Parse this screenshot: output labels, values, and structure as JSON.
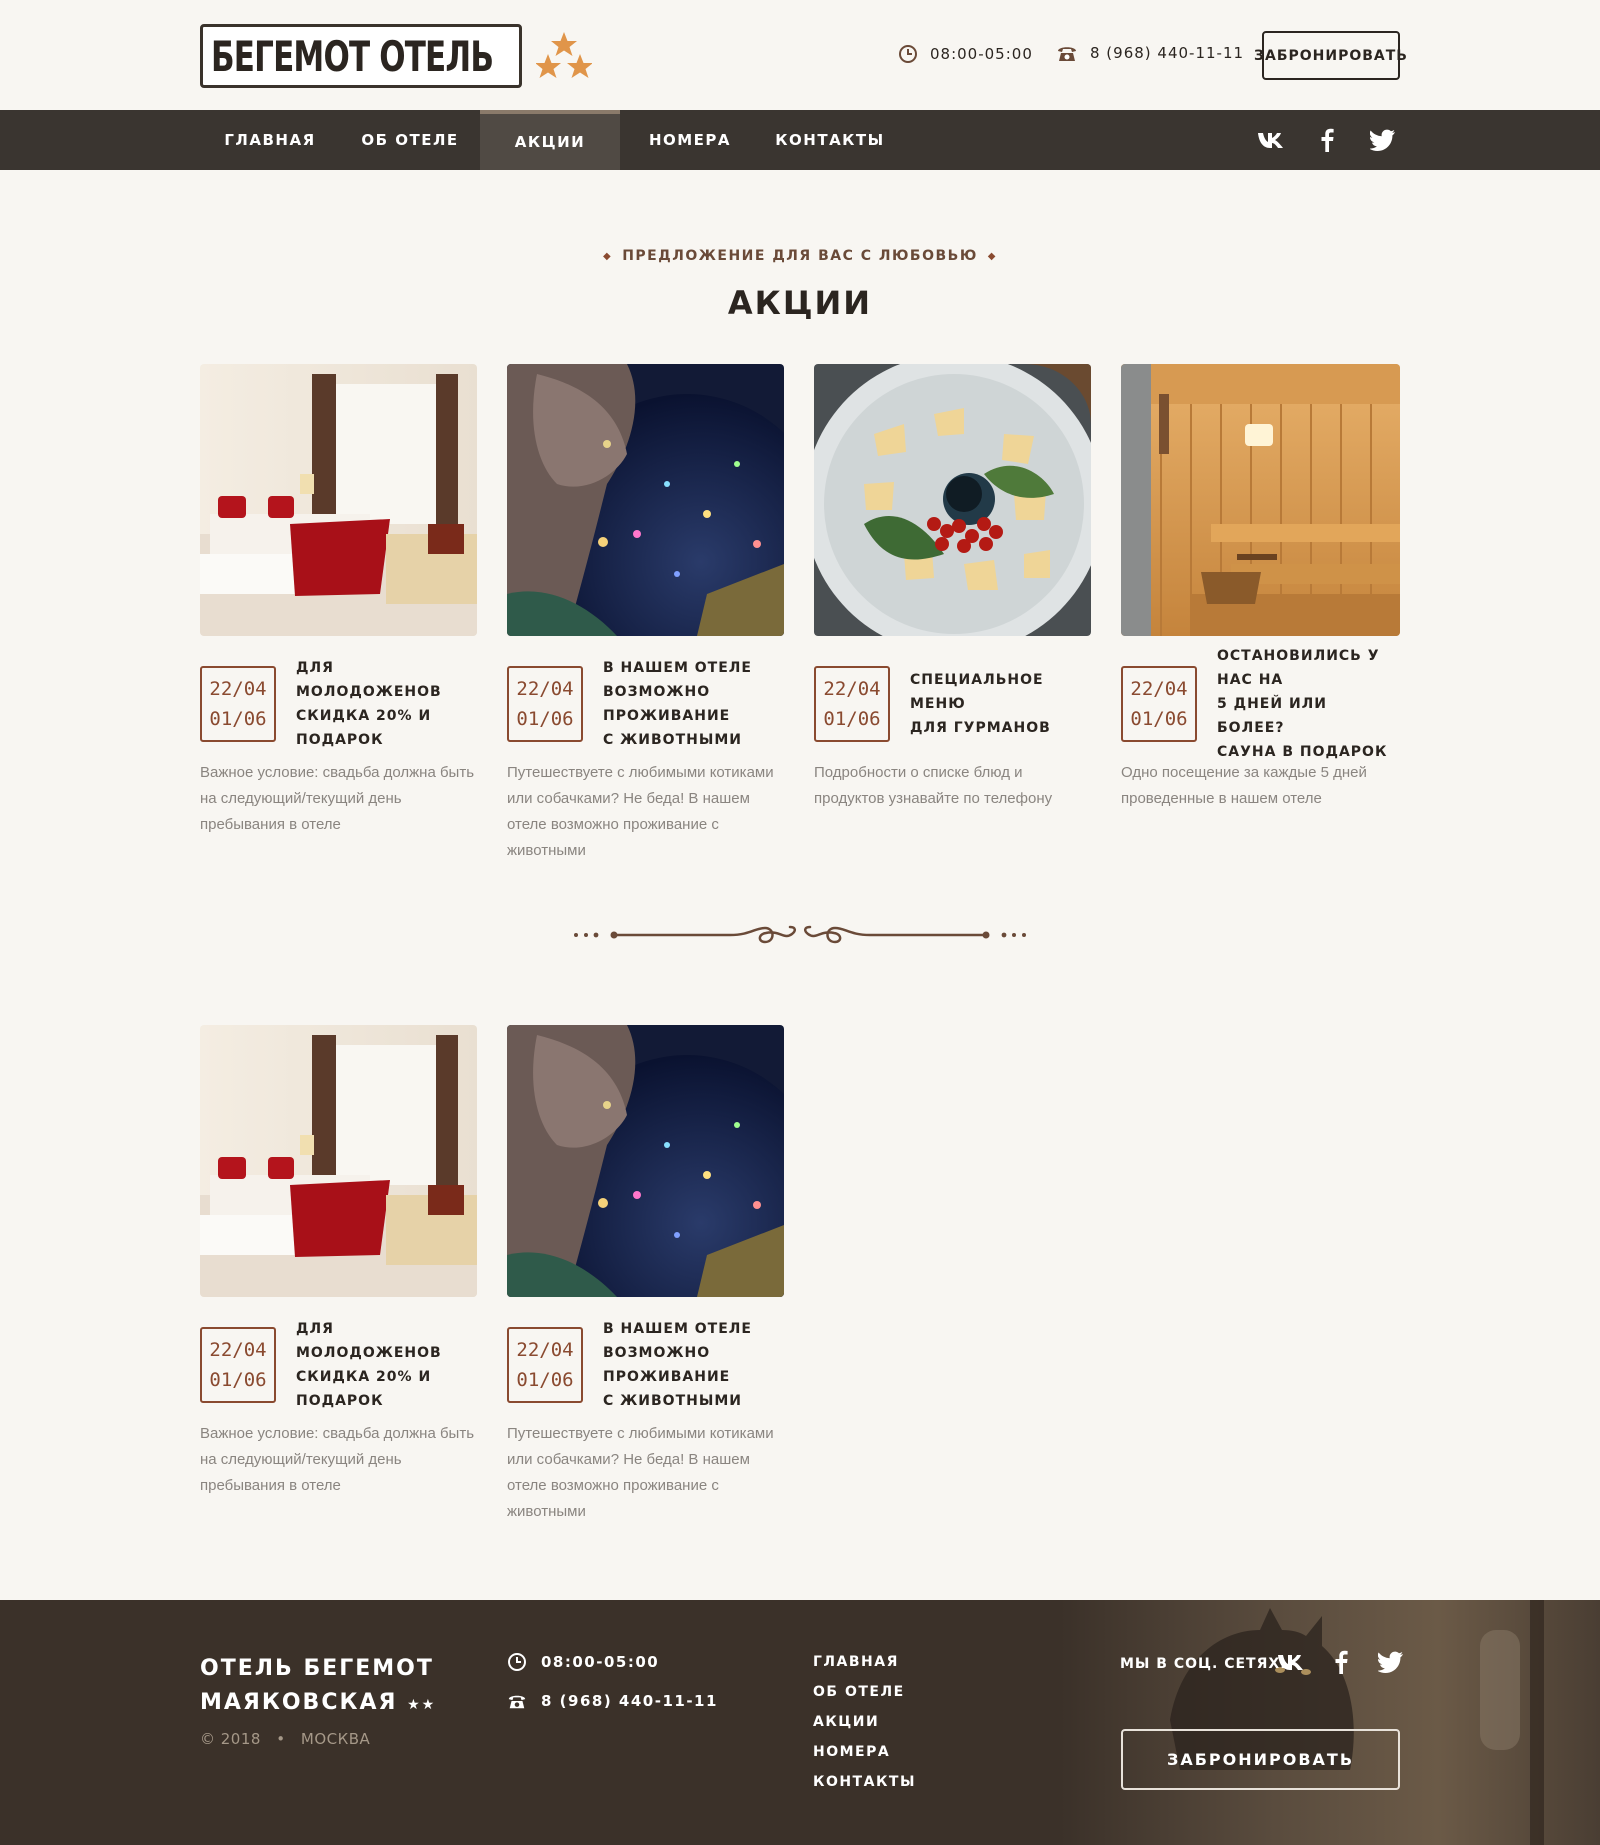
{
  "header": {
    "logo_text": "БЕГЕМОТ ОТЕЛЬ",
    "hours": "08:00-05:00",
    "phone": "8 (968) 440-11-11",
    "book_label": "ЗАБРОНИРОВАТЬ"
  },
  "nav": {
    "items": [
      {
        "label": "ГЛАВНАЯ"
      },
      {
        "label": "ОБ ОТЕЛЕ"
      },
      {
        "label": "АКЦИИ"
      },
      {
        "label": "НОМЕРА"
      },
      {
        "label": "КОНТАКТЫ"
      }
    ],
    "active": "АКЦИИ"
  },
  "section": {
    "subtitle": "ПРЕДЛОЖЕНИЕ ДЛЯ ВАС С ЛЮБОВЬЮ",
    "title": "АКЦИИ"
  },
  "cards": [
    {
      "date_from": "22/04",
      "date_to": "01/06",
      "title_l1": "ДЛЯ МОЛОДОЖЕНОВ",
      "title_l2": "СКИДКА 20% И ПОДАРОК",
      "title_l3": "",
      "desc": "Важное условие: свадьба должна быть на следующий/текущий день пребывания в отеле"
    },
    {
      "date_from": "22/04",
      "date_to": "01/06",
      "title_l1": "В НАШЕМ ОТЕЛЕ",
      "title_l2": "ВОЗМОЖНО ПРОЖИВАНИЕ",
      "title_l3": "С ЖИВОТНЫМИ",
      "desc": "Путешествуете с любимыми котиками или собачками? Не беда! В нашем отеле возможно проживание с животными"
    },
    {
      "date_from": "22/04",
      "date_to": "01/06",
      "title_l1": "СПЕЦИАЛЬНОЕ МЕНЮ",
      "title_l2": "ДЛЯ ГУРМАНОВ",
      "title_l3": "",
      "desc": "Подробности о списке блюд и продуктов узнавайте по телефону"
    },
    {
      "date_from": "22/04",
      "date_to": "01/06",
      "title_l1": "ОСТАНОВИЛИСЬ У НАС НА",
      "title_l2": "5 ДНЕЙ ИЛИ БОЛЕЕ?",
      "title_l3": "САУНА В ПОДАРОК",
      "desc": "Одно посещение за каждые 5 дней проведенные в нашем отеле"
    },
    {
      "date_from": "22/04",
      "date_to": "01/06",
      "title_l1": "ДЛЯ МОЛОДОЖЕНОВ",
      "title_l2": "СКИДКА 20% И ПОДАРОК",
      "title_l3": "",
      "desc": "Важное условие: свадьба должна быть на следующий/текущий день пребывания в отеле"
    },
    {
      "date_from": "22/04",
      "date_to": "01/06",
      "title_l1": "В НАШЕМ ОТЕЛЕ",
      "title_l2": "ВОЗМОЖНО ПРОЖИВАНИЕ",
      "title_l3": "С ЖИВОТНЫМИ",
      "desc": "Путешествуете с любимыми котиками или собачками? Не беда! В нашем отеле возможно проживание с животными"
    }
  ],
  "footer": {
    "logo_l1": "ОТЕЛЬ БЕГЕМОТ",
    "logo_l2": "МАЯКОВСКАЯ",
    "copy": "© 2018",
    "city": "МОСКВА",
    "hours": "08:00-05:00",
    "phone": "8 (968) 440-11-11",
    "nav": [
      "ГЛАВНАЯ",
      "ОБ ОТЕЛЕ",
      "АКЦИИ",
      "НОМЕРА",
      "КОНТАКТЫ"
    ],
    "social_label": "МЫ В СОЦ. СЕТЯХ:",
    "book_label": "ЗАБРОНИРОВАТЬ"
  },
  "colors": {
    "accent": "#8a4a30",
    "nav_bg": "#3a3530",
    "footer_bg": "#3b3129",
    "star": "#e0954a"
  }
}
